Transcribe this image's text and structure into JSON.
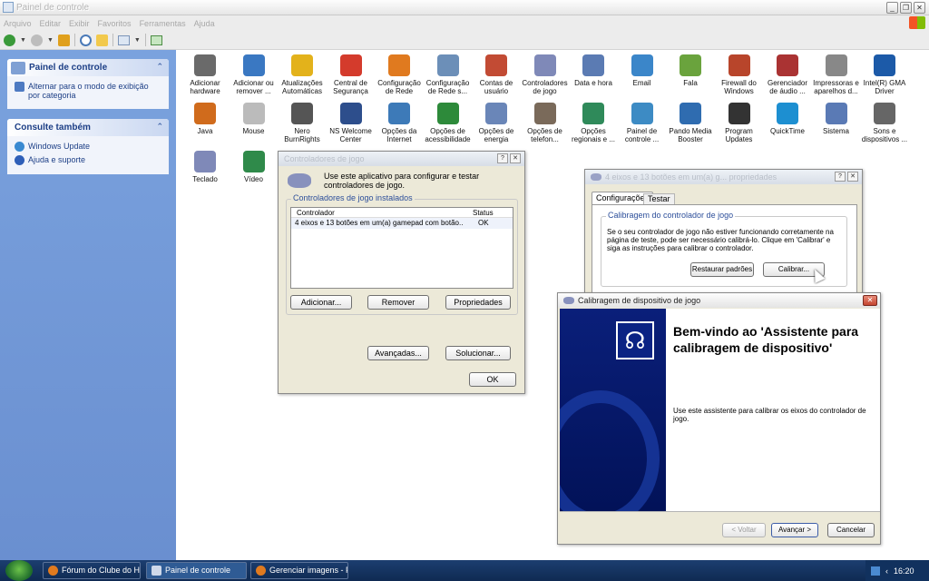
{
  "window": {
    "title": "Painel de controle"
  },
  "menu": [
    "Arquivo",
    "Editar",
    "Exibir",
    "Favoritos",
    "Ferramentas",
    "Ajuda"
  ],
  "sidebar": {
    "panel1": {
      "title": "Painel de controle",
      "link": "Alternar para o modo de exibição por categoria"
    },
    "panel2": {
      "title": "Consulte também",
      "links": [
        "Windows Update",
        "Ajuda e suporte"
      ]
    }
  },
  "icons": [
    {
      "label": "Adicionar hardware",
      "color": "#6a6a6a"
    },
    {
      "label": "Adicionar ou remover ...",
      "color": "#3a78c2"
    },
    {
      "label": "Atualizações Automáticas",
      "color": "#e3b21b"
    },
    {
      "label": "Central de Segurança",
      "color": "#d43b2c"
    },
    {
      "label": "Configuração de Rede",
      "color": "#e07a1f"
    },
    {
      "label": "Configuração de Rede s...",
      "color": "#6c8fb8"
    },
    {
      "label": "Contas de usuário",
      "color": "#c24b34"
    },
    {
      "label": "Controladores de jogo",
      "color": "#7f89b8"
    },
    {
      "label": "Data e hora",
      "color": "#5b7bb3"
    },
    {
      "label": "Email",
      "color": "#3b86c9"
    },
    {
      "label": "Fala",
      "color": "#6aa33d"
    },
    {
      "label": "Firewall do Windows",
      "color": "#b8452b"
    },
    {
      "label": "Gerenciador de áudio ...",
      "color": "#a33"
    },
    {
      "label": "Impressoras e aparelhos d...",
      "color": "#888"
    },
    {
      "label": "Intel(R) GMA Driver",
      "color": "#1c5aa8"
    },
    {
      "label": "Java",
      "color": "#d06b1c"
    },
    {
      "label": "Mouse",
      "color": "#bbb"
    },
    {
      "label": "Nero BurnRights",
      "color": "#555"
    },
    {
      "label": "NS Welcome Center",
      "color": "#2d4e8c"
    },
    {
      "label": "Opções da Internet",
      "color": "#3d7ab8"
    },
    {
      "label": "Opções de acessibilidade",
      "color": "#2d8a3a"
    },
    {
      "label": "Opções de energia",
      "color": "#6a86b8"
    },
    {
      "label": "Opções de telefon...",
      "color": "#7a6a5a"
    },
    {
      "label": "Opções regionais e ...",
      "color": "#2f8a5a"
    },
    {
      "label": "Painel de controle ...",
      "color": "#3d8bc4"
    },
    {
      "label": "Pando Media Booster",
      "color": "#2f6cb0"
    },
    {
      "label": "Program Updates",
      "color": "#333"
    },
    {
      "label": "QuickTime",
      "color": "#1d8fd1"
    },
    {
      "label": "Sistema",
      "color": "#5a7ab5"
    },
    {
      "label": "Sons e dispositivos ...",
      "color": "#666"
    },
    {
      "label": "Teclado",
      "color": "#7f89b8"
    },
    {
      "label": "Vídeo",
      "color": "#2f8a4a"
    }
  ],
  "game_dialog": {
    "title": "Controladores de jogo",
    "desc": "Use este aplicativo para configurar e testar controladores de jogo.",
    "group": "Controladores de jogo instalados",
    "col_controller": "Controlador",
    "col_status": "Status",
    "row_controller": "4 eixos e 13 botões em um(a) gamepad com botão...",
    "row_status": "OK",
    "btn_add": "Adicionar...",
    "btn_remove": "Remover",
    "btn_props": "Propriedades",
    "btn_advanced": "Avançadas...",
    "btn_troubleshoot": "Solucionar...",
    "btn_ok": "OK"
  },
  "props_dialog": {
    "title": "4 eixos e 13 botões em um(a) g... propriedades",
    "tab1": "Configurações",
    "tab2": "Testar",
    "group": "Calibragem do controlador de jogo",
    "text": "Se o seu controlador de jogo não estiver funcionando corretamente na página de teste, pode ser necessário calibrá-lo. Clique em 'Calibrar' e siga as instruções para calibrar o controlador.",
    "btn_restore": "Restaurar padrões",
    "btn_calibrate": "Calibrar..."
  },
  "wizard": {
    "title": "Calibragem de dispositivo de jogo",
    "heading": "Bem-vindo ao 'Assistente para calibragem de dispositivo'",
    "body": "Use este assistente para calibrar os eixos do controlador de jogo.",
    "btn_back": "< Voltar",
    "btn_next": "Avançar >",
    "btn_cancel": "Cancelar"
  },
  "taskbar": {
    "tasks": [
      "Fórum do Clube do Ha...",
      "Painel de controle",
      "Gerenciar imagens - F..."
    ],
    "clock": "16:20"
  }
}
